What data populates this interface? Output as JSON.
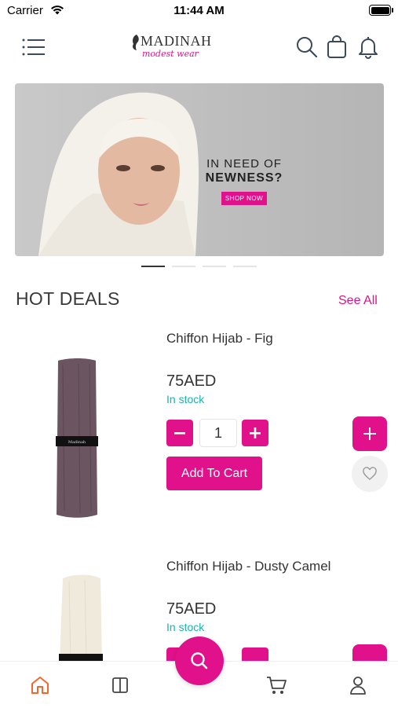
{
  "status_bar": {
    "carrier": "Carrier",
    "time": "11:44 AM"
  },
  "header": {
    "logo_line1": "MADINAH",
    "logo_line2": "modest wear"
  },
  "banner": {
    "line1": "IN NEED OF",
    "line2": "NEWNESS?",
    "cta": "SHOP NOW",
    "slides": 4,
    "active_slide": 1
  },
  "section": {
    "title": "HOT DEALS",
    "see_all": "See All"
  },
  "products": [
    {
      "name": "Chiffon Hijab - Fig",
      "price": "75AED",
      "stock": "In stock",
      "quantity": "1",
      "add_to_cart": "Add To Cart"
    },
    {
      "name": "Chiffon Hijab - Dusty Camel",
      "price": "75AED",
      "stock": "In stock"
    }
  ],
  "colors": {
    "accent": "#e0118a",
    "stock": "#14b5b0",
    "nav_active": "#f0692b"
  },
  "icons": [
    "menu-icon",
    "search-icon",
    "bag-icon",
    "bell-icon",
    "home-icon",
    "categories-icon",
    "cart-icon",
    "profile-icon",
    "heart-icon"
  ]
}
